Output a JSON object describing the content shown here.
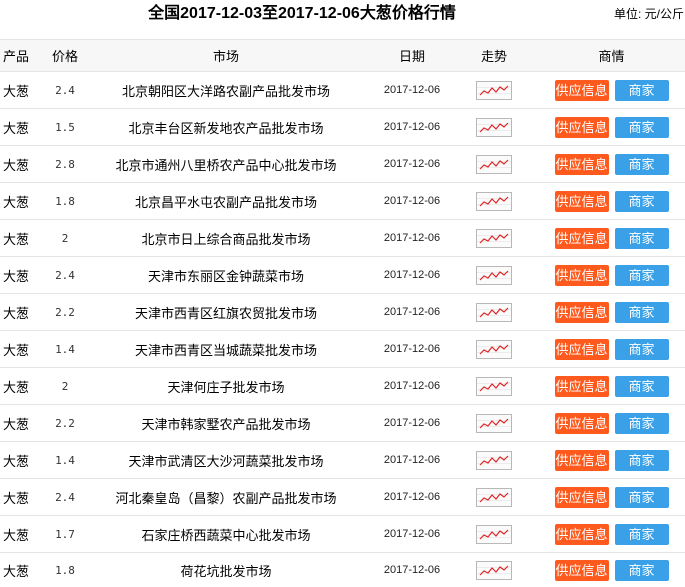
{
  "page": {
    "title": "全国2017-12-03至2017-12-06大葱价格行情",
    "unit": "单位: 元/公斤"
  },
  "table": {
    "headers": {
      "product": "产品",
      "price": "价格",
      "market": "市场",
      "date": "日期",
      "trend": "走势",
      "info": "商情"
    },
    "supply_label": "供应信息",
    "merchant_label": "商家",
    "rows": [
      {
        "product": "大葱",
        "price": "2.4",
        "market": "北京朝阳区大洋路农副产品批发市场",
        "date": "2017-12-06"
      },
      {
        "product": "大葱",
        "price": "1.5",
        "market": "北京丰台区新发地农产品批发市场",
        "date": "2017-12-06"
      },
      {
        "product": "大葱",
        "price": "2.8",
        "market": "北京市通州八里桥农产品中心批发市场",
        "date": "2017-12-06"
      },
      {
        "product": "大葱",
        "price": "1.8",
        "market": "北京昌平水屯农副产品批发市场",
        "date": "2017-12-06"
      },
      {
        "product": "大葱",
        "price": "2",
        "market": "北京市日上综合商品批发市场",
        "date": "2017-12-06"
      },
      {
        "product": "大葱",
        "price": "2.4",
        "market": "天津市东丽区金钟蔬菜市场",
        "date": "2017-12-06"
      },
      {
        "product": "大葱",
        "price": "2.2",
        "market": "天津市西青区红旗农贸批发市场",
        "date": "2017-12-06"
      },
      {
        "product": "大葱",
        "price": "1.4",
        "market": "天津市西青区当城蔬菜批发市场",
        "date": "2017-12-06"
      },
      {
        "product": "大葱",
        "price": "2",
        "market": "天津何庄子批发市场",
        "date": "2017-12-06"
      },
      {
        "product": "大葱",
        "price": "2.2",
        "market": "天津市韩家墅农产品批发市场",
        "date": "2017-12-06"
      },
      {
        "product": "大葱",
        "price": "1.4",
        "market": "天津市武清区大沙河蔬菜批发市场",
        "date": "2017-12-06"
      },
      {
        "product": "大葱",
        "price": "2.4",
        "market": "河北秦皇岛（昌黎）农副产品批发市场",
        "date": "2017-12-06"
      },
      {
        "product": "大葱",
        "price": "1.7",
        "market": "石家庄桥西蔬菜中心批发市场",
        "date": "2017-12-06"
      },
      {
        "product": "大葱",
        "price": "1.8",
        "market": "荷花坑批发市场",
        "date": "2017-12-06"
      }
    ]
  },
  "colors": {
    "supply_button": "#ff5a1e",
    "merchant_button": "#3aa1e8",
    "trend_line": "#e02424"
  },
  "icons": {
    "trend": "trend-chart-icon"
  }
}
